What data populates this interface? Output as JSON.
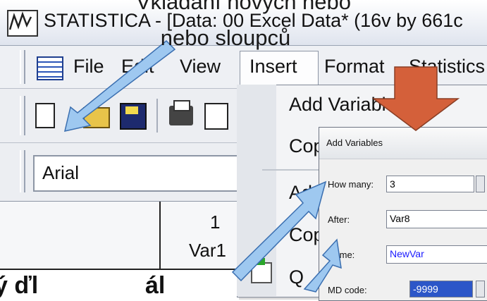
{
  "slide": {
    "title_line1": "Vkládání nových nebo",
    "title_line2": "nebo sloupců",
    "bottom_text": "ý ďl",
    "bottom_text2": "ál"
  },
  "window": {
    "title": "STATISTICA - [Data: 00 Excel Data* (16v by 661c"
  },
  "menu": {
    "file": "File",
    "edit": "Edit",
    "view": "View",
    "insert": "Insert",
    "format": "Format",
    "statistics": "Statistics"
  },
  "toolbar": {
    "font_name": "Arial"
  },
  "grid": {
    "col_number": "1",
    "col_name": "Var1"
  },
  "insert_menu": {
    "add_variables": "Add Variables...",
    "copy_variables": "Copy Variables...",
    "add_cases": "Add Cases...",
    "copy_cases": "Copy Cases...",
    "item5": "Q"
  },
  "dialog": {
    "title": "Add Variables",
    "how_many_label": "How many:",
    "how_many_value": "3",
    "after_label": "After:",
    "after_value": "Var8",
    "name_label": "Name:",
    "name_value": "NewVar",
    "md_code_label": "MD code:",
    "md_code_value": "-9999"
  },
  "colors": {
    "arrow_blue": "#9ec8f0",
    "arrow_red": "#d4603a",
    "name_text": "#1a1aff"
  }
}
